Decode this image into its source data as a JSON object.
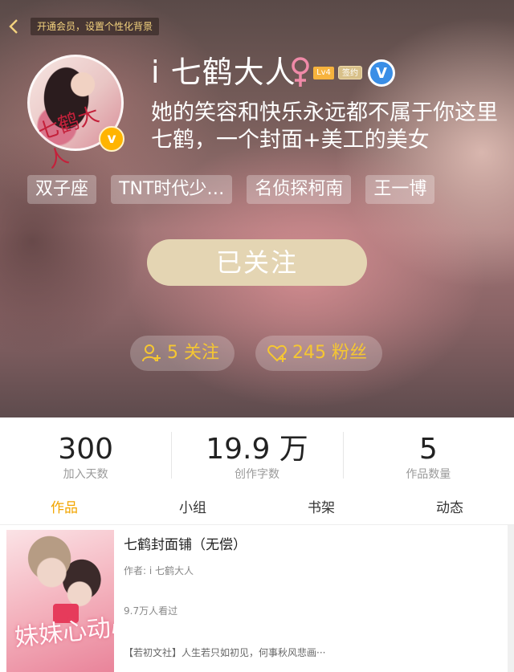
{
  "header": {
    "back_icon": "chevron-left-icon",
    "vip_banner": "开通会员，设置个性化背景"
  },
  "profile": {
    "avatar_text": "七鹤大人",
    "username": "i 七鹤大人",
    "gender_icon": "female-icon",
    "level": "Lv4",
    "signed": "签约",
    "verified_icon": "v-badge-icon",
    "bio": "她的笑容和快乐永远都不属于你这里七鹤，一个封面+美工的美女",
    "tags": [
      "双子座",
      "TNT时代少…",
      "名侦探柯南",
      "王一博"
    ],
    "follow_button": "已关注",
    "following": "5 关注",
    "fans": "245 粉丝",
    "colors": {
      "accent": "#f2a500",
      "pill_text": "#f6c731",
      "follow_bg": "#e4d5b3"
    }
  },
  "stats": [
    {
      "value": "300",
      "label": "加入天数"
    },
    {
      "value": "19.9 万",
      "label": "创作字数"
    },
    {
      "value": "5",
      "label": "作品数量"
    }
  ],
  "tabs": [
    {
      "label": "作品",
      "active": true
    },
    {
      "label": "小组",
      "active": false
    },
    {
      "label": "书架",
      "active": false
    },
    {
      "label": "动态",
      "active": false
    }
  ],
  "work": {
    "cover_text": "妹妹心动心动",
    "title": "七鹤封面铺（无偿）",
    "author": "作者: i 七鹤大人",
    "views": "9.7万人看过",
    "description": "【若初文社】人生若只如初见，何事秋风悲画···"
  }
}
